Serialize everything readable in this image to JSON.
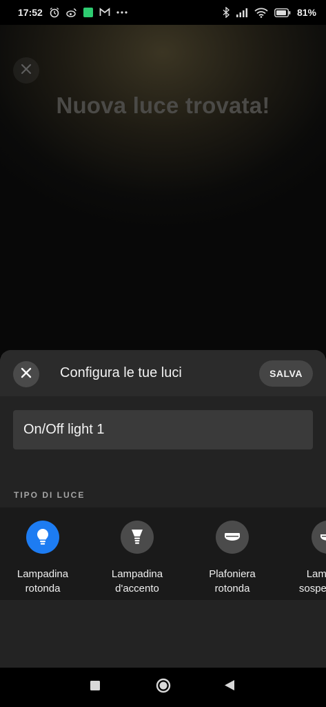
{
  "status_bar": {
    "time": "17:52",
    "left_icons": [
      "alarm-icon",
      "weibo-icon",
      "evernote-icon",
      "gmail-icon",
      "more-icon"
    ],
    "battery_percent": "81%"
  },
  "background": {
    "title": "Nuova luce trovata!"
  },
  "sheet": {
    "title": "Configura le tue luci",
    "save_label": "SALVA",
    "light_name": "On/Off light 1",
    "section_label": "TIPO DI LUCE",
    "light_types": [
      {
        "label_line1": "Lampadina",
        "label_line2": "rotonda",
        "icon": "bulb-round-icon",
        "selected": true
      },
      {
        "label_line1": "Lampadina",
        "label_line2": "d'accento",
        "icon": "bulb-accent-icon",
        "selected": false
      },
      {
        "label_line1": "Plafoniera",
        "label_line2": "rotonda",
        "icon": "ceiling-round-icon",
        "selected": false
      },
      {
        "label_line1": "Lampada",
        "label_line2": "sospensione",
        "icon": "pendant-icon",
        "selected": false
      }
    ]
  },
  "colors": {
    "accent": "#1d7cf2",
    "sheet_bg": "#232323",
    "field_bg": "#3a3a3a"
  }
}
